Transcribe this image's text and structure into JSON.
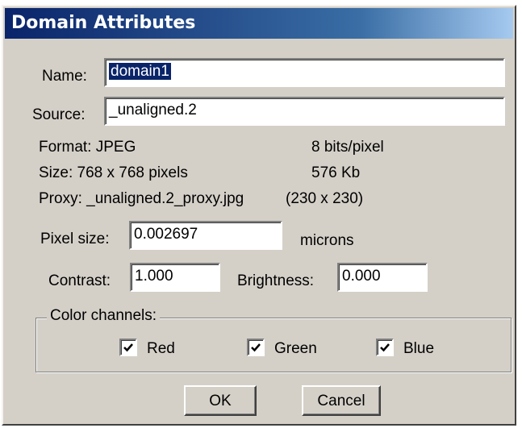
{
  "window": {
    "title": "Domain Attributes"
  },
  "name": {
    "label": "Name:",
    "value": "domain1"
  },
  "source": {
    "label": "Source:",
    "value": "_unaligned.2"
  },
  "info": {
    "format": "Format: JPEG",
    "bits": "8 bits/pixel",
    "size": "Size: 768 x 768 pixels",
    "filesize": "576 Kb",
    "proxy": "Proxy: _unaligned.2_proxy.jpg",
    "proxy_dims": "(230 x 230)"
  },
  "pixel_size": {
    "label": "Pixel size:",
    "value": "0.002697",
    "unit": "microns"
  },
  "contrast": {
    "label": "Contrast:",
    "value": "1.000"
  },
  "brightness": {
    "label": "Brightness:",
    "value": "0.000"
  },
  "color_channels": {
    "label": "Color channels:",
    "red": {
      "label": "Red",
      "checked": true
    },
    "green": {
      "label": "Green",
      "checked": true
    },
    "blue": {
      "label": "Blue",
      "checked": true
    }
  },
  "buttons": {
    "ok": "OK",
    "cancel": "Cancel"
  }
}
